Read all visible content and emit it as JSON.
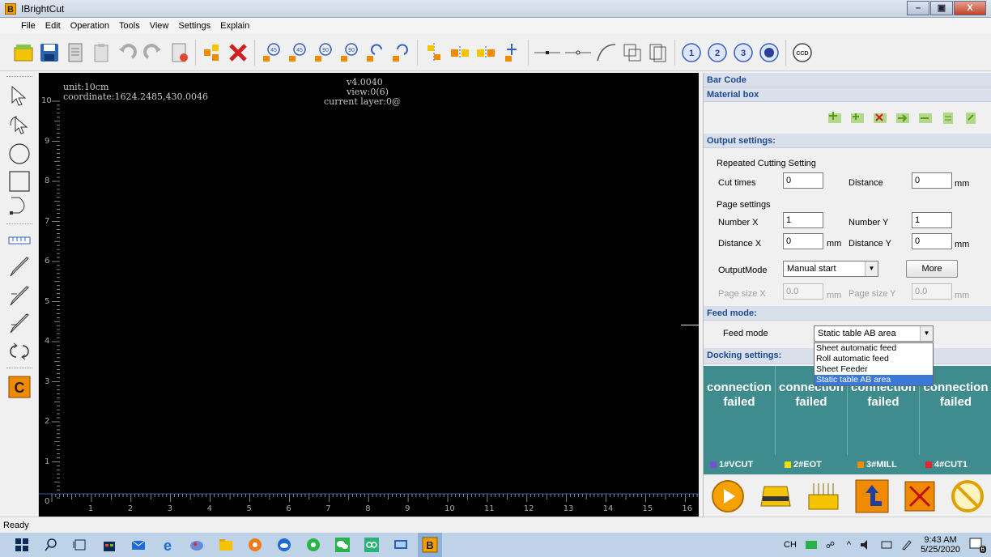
{
  "window": {
    "title": "IBrightCut",
    "logo_letter": "B",
    "btn_min": "–",
    "btn_max": "▣",
    "btn_close": "X"
  },
  "menu": [
    "File",
    "Edit",
    "Operation",
    "Tools",
    "View",
    "Settings",
    "Explain"
  ],
  "toolbar_icons": [
    "open-icon",
    "save-icon",
    "document-icon",
    "clipboard-icon",
    "undo-icon",
    "redo-icon",
    "import-icon",
    "group-icon",
    "delete-icon",
    "rotate-45-left-icon",
    "rotate-45-right-icon",
    "rotate-90-left-icon",
    "rotate-90-right-icon",
    "rotate-left-icon",
    "rotate-right-icon",
    "align-icon",
    "mirror-h-icon",
    "mirror-v-icon",
    "move-icon",
    "line-dash-icon",
    "line-node-icon",
    "curve-icon",
    "rect-icon",
    "multi-rect-icon",
    "mark-1-icon",
    "mark-2-icon",
    "mark-3-icon",
    "mark-circle-icon",
    "ccd-icon"
  ],
  "toolbar_text": {
    "mark1": "1",
    "mark2": "2",
    "mark3": "3",
    "ccd": "CCD",
    "rot45": "45",
    "rot90": "90"
  },
  "canvas": {
    "unit": "unit:10cm",
    "coordinate": "coordinate:1624.2485,430.0046",
    "version": "v4.0040",
    "view": "view:0(6)",
    "layer": "current layer:0@",
    "vticks": [
      "10",
      "9",
      "8",
      "7",
      "6",
      "5",
      "4",
      "3",
      "2",
      "1",
      "0"
    ],
    "hticks": [
      "1",
      "2",
      "3",
      "4",
      "5",
      "6",
      "7",
      "8",
      "9",
      "10",
      "11",
      "12",
      "13",
      "14",
      "15",
      "16"
    ]
  },
  "panel": {
    "barcode": "Bar Code",
    "material": "Material box",
    "output_settings": "Output settings:",
    "repeated_group": "Repeated Cutting Setting",
    "cut_times_label": "Cut times",
    "cut_times": "0",
    "distance_label": "Distance",
    "distance": "0",
    "mm": "mm",
    "page_group": "Page settings",
    "number_x_label": "Number X",
    "number_x": "1",
    "number_y_label": "Number Y",
    "number_y": "1",
    "distance_x_label": "Distance X",
    "distance_x": "0",
    "distance_y_label": "Distance Y",
    "distance_y": "0",
    "output_mode_label": "OutputMode",
    "output_mode": "Manual start",
    "more": "More",
    "page_size_x_label": "Page size X",
    "page_size_x": "0.0",
    "page_size_y_label": "Page size Y",
    "page_size_y": "0.0",
    "feed_mode_head": "Feed mode:",
    "feed_mode_label": "Feed mode",
    "feed_mode": "Static table AB area",
    "feed_options": [
      "Sheet automatic feed",
      "Roll automatic feed",
      "Sheet Feeder",
      "Static table AB area"
    ],
    "docking": "Docking settings:",
    "connections": [
      {
        "status1": "connection",
        "status2": "failed",
        "label": "1#VCUT",
        "color": "#7a4fd8"
      },
      {
        "status1": "connection",
        "status2": "failed",
        "label": "2#EOT",
        "color": "#f0e000"
      },
      {
        "status1": "connection",
        "status2": "failed",
        "label": "3#MILL",
        "color": "#f08a00"
      },
      {
        "status1": "connection",
        "status2": "failed",
        "label": "4#CUT1",
        "color": "#e8242a"
      }
    ]
  },
  "status": "Ready",
  "taskbar": {
    "ime": "CH",
    "time": "9:43 AM",
    "date": "5/25/2020",
    "notif": "6"
  }
}
